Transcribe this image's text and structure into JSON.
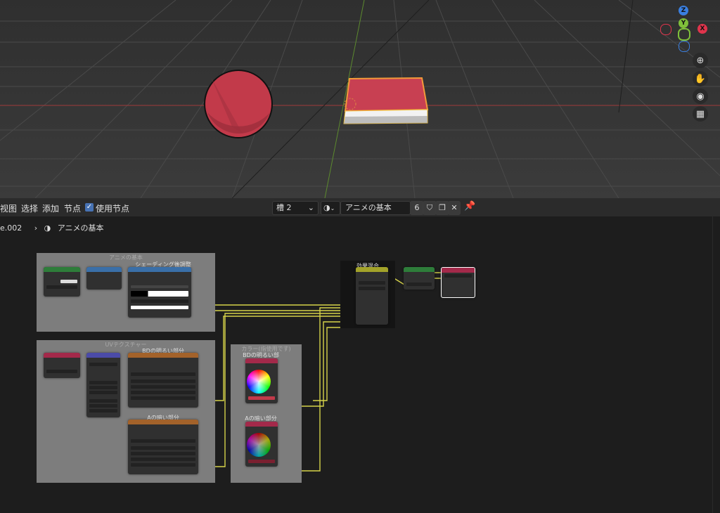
{
  "header": {
    "menu": [
      "视图",
      "选择",
      "添加",
      "节点"
    ],
    "use_nodes_label": "使用节点",
    "slot_value": "槽 2",
    "material_name": "アニメの基本",
    "user_count": "6"
  },
  "breadcrumb": {
    "object": "e.002",
    "material": "アニメの基本"
  },
  "frames": {
    "anime_basic": "アニメの基本",
    "uv_texture": "UVテクスチャー",
    "color": "カラー(指使用です)"
  },
  "nodes": {
    "shading_adjust": "シェーディング後調整",
    "effect_mix": "効果混合",
    "bd_bright": "BDの明るい部分",
    "a_dark": "Aの暗い部分",
    "bd_bright2": "BDの明るい部分",
    "a_dark2": "Aの暗い部分"
  },
  "colors": {
    "wire": "#d6d34a",
    "wire_blue": "#6c6ce6",
    "sphere": "#c23a4a",
    "book": "#c23a4a",
    "axis_x": "#e0344c",
    "axis_y": "#7fbf3a",
    "axis_z": "#3a7fe0"
  },
  "gizmo": {
    "z": "Z",
    "y": "Y",
    "x": "X"
  }
}
